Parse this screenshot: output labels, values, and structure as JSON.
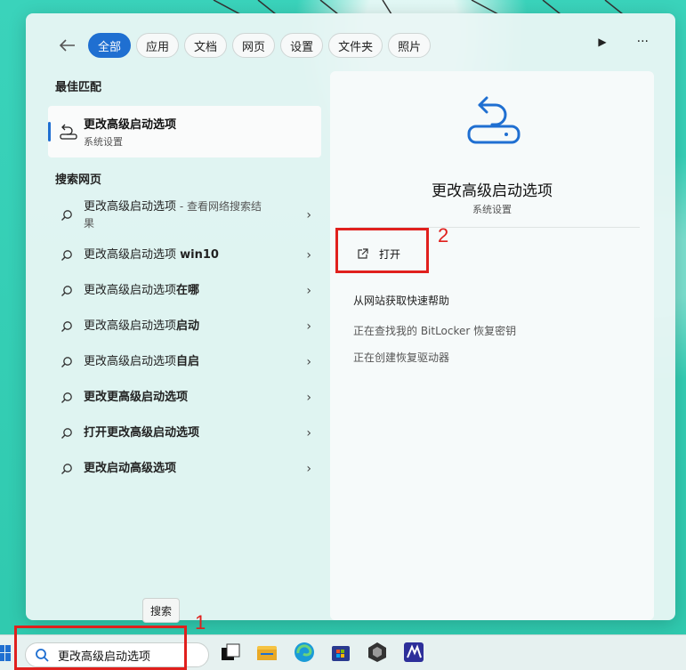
{
  "filters": {
    "items": [
      "全部",
      "应用",
      "文档",
      "网页",
      "设置",
      "文件夹",
      "照片"
    ],
    "active_index": 0
  },
  "header_buttons": {
    "play": "▶",
    "more": "···"
  },
  "best_match": {
    "section_title": "最佳匹配",
    "title": "更改高级启动选项",
    "subtitle": "系统设置"
  },
  "web_search": {
    "section_title": "搜索网页",
    "items": [
      {
        "prefix": "更改高级启动选项",
        "bold": "",
        "suffix": " - 查看网络搜索结果"
      },
      {
        "prefix": "更改高级启动选项 ",
        "bold": "win10",
        "suffix": ""
      },
      {
        "prefix": "更改高级启动选项",
        "bold": "在哪",
        "suffix": ""
      },
      {
        "prefix": "更改高级启动选项",
        "bold": "启动",
        "suffix": ""
      },
      {
        "prefix": "更改高级启动选项",
        "bold": "自启",
        "suffix": ""
      },
      {
        "prefix": "",
        "bold": "更改更高级启动选项",
        "suffix": ""
      },
      {
        "prefix": "",
        "bold": "打开更改高级启动选项",
        "suffix": ""
      },
      {
        "prefix": "",
        "bold": "更改启动高级选项",
        "suffix": ""
      }
    ]
  },
  "detail": {
    "title": "更改高级启动选项",
    "subtitle": "系统设置",
    "open_label": "打开",
    "action_help": "从网站获取快速帮助",
    "action_bitlocker": "正在查找我的 BitLocker 恢复密钥",
    "action_recovery": "正在创建恢复驱动器"
  },
  "annotations": {
    "step1": "1",
    "step2": "2"
  },
  "tooltip": "搜索",
  "taskbar": {
    "search_value": "更改高级启动选项",
    "icons": [
      "task-view-icon",
      "file-explorer-icon",
      "edge-icon",
      "store-icon",
      "app-icon",
      "app2-icon"
    ]
  },
  "colors": {
    "accent": "#1f6fd1",
    "highlight": "#e0201d",
    "background": "#35d0b6"
  }
}
